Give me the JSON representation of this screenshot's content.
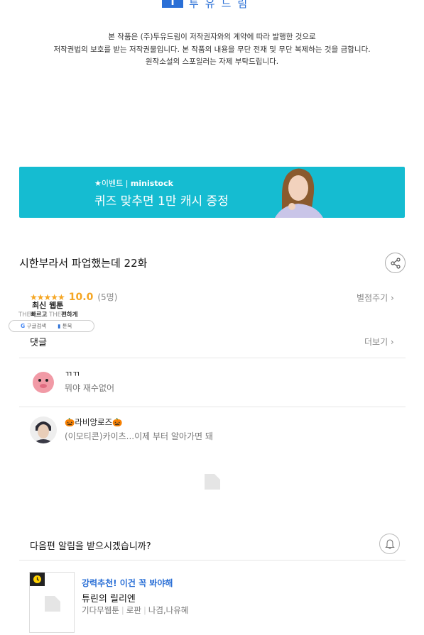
{
  "publisher": {
    "logo_mark": "T",
    "logo_text": "투유드림"
  },
  "copyright": {
    "line1": "본 작품은 (주)투유드림이 저작권자와의 계약에 따라 발행한 것으로",
    "line2": "저작권법의 보호를 받는 저작권물입니다. 본 작품의 내용을 무단 전재 및 무단 복제하는 것을 금합니다.",
    "line3": "원작소설의 스포일러는 자제 부탁드립니다."
  },
  "banner": {
    "event_prefix": "★이벤트 | ",
    "brand": "ministock",
    "title": "퀴즈 맞추면 1만 캐시 증정",
    "bg_color": "#15bcd1"
  },
  "episode": {
    "title": "시한부라서 파업했는데 22화",
    "share_icon": "share-icon"
  },
  "rating": {
    "stars": "★★★★★",
    "score": "10.0",
    "count": "(5명)",
    "rate_link": "별점주기 ›"
  },
  "overlay_ad": {
    "title": "최신 웹툰",
    "sub_the1": "THE",
    "sub_word1": "빠르고",
    "sub_the2": "THE",
    "sub_word2": "편하게",
    "pill_left": "구글검색",
    "pill_right": "툰북"
  },
  "comments": {
    "header": "댓글",
    "more_link": "더보기 ›",
    "items": [
      {
        "name": "ㄲㄲ",
        "text": "뭐야 재수없어"
      },
      {
        "name": "🎃라비앙로즈🎃",
        "text": "(이모티콘)카이츠...이제 부터 알아가면 돼"
      }
    ]
  },
  "notify": {
    "text": "다음편 알림을 받으시겠습니까?",
    "icon": "bell-icon"
  },
  "recommend": {
    "tag": "강력추천! 이건 꼭 봐야해",
    "title": "튜린의 릴리엔",
    "genre": "기다무웹툰",
    "category": "로판",
    "authors": "나겸,나유혜"
  }
}
